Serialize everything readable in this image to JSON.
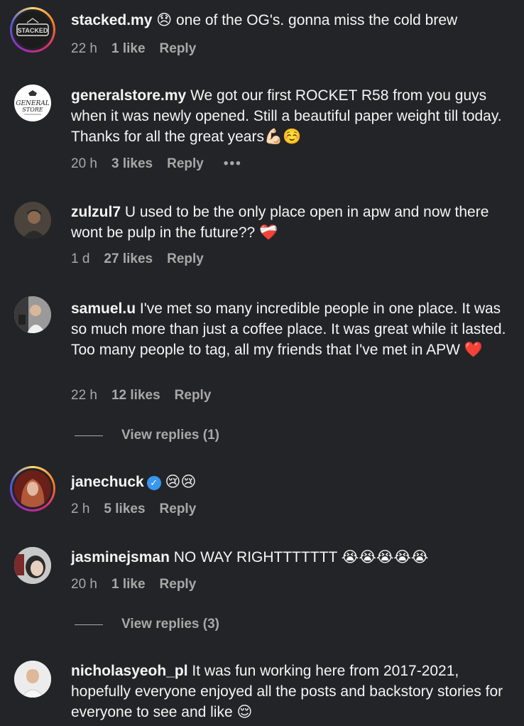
{
  "comments": [
    {
      "username": "stacked.my",
      "text": " 😞 one of the OG's. gonna miss the cold brew",
      "time": "22 h",
      "likes": "1 like",
      "reply": "Reply"
    },
    {
      "username": "generalstore.my",
      "text": " We got our first ROCKET R58 from you guys when it was newly opened. Still a beautiful paper weight till today. Thanks for all the great years💪🏻☺️",
      "time": "20 h",
      "likes": "3 likes",
      "reply": "Reply",
      "more": "•••"
    },
    {
      "username": "zulzul7",
      "text": " U used to be the only place open in apw and now there wont be pulp in the future?? ❤️‍🩹",
      "time": "1 d",
      "likes": "27 likes",
      "reply": "Reply"
    },
    {
      "username": "samuel.u",
      "text": " I've met so many incredible people in one place. It was so much more than just a coffee place. It was great while it lasted. Too many people to tag, all my friends that I've met in APW ❤️",
      "time": "22 h",
      "likes": "12 likes",
      "reply": "Reply",
      "view_replies": "View replies (1)"
    },
    {
      "username": "janechuck",
      "text": " 😢😢",
      "time": "2 h",
      "likes": "5 likes",
      "reply": "Reply"
    },
    {
      "username": "jasminejsman",
      "text": " NO WAY RIGHTTTTTTT 😭😭😭😭😭",
      "time": "20 h",
      "likes": "1 like",
      "reply": "Reply",
      "view_replies": "View replies (3)"
    },
    {
      "username": "nicholasyeoh_pl",
      "text": " It was fun working here from 2017-2021, hopefully everyone enjoyed all the posts and backstory stories for everyone to see and like 😌"
    }
  ],
  "logos": {
    "stacked": "STACKED",
    "general_top": "GENERAL",
    "general_bottom": "STORE"
  },
  "colors": {
    "background": "#232427",
    "text": "#f5f5f5",
    "muted": "#a8a8a8",
    "verified": "#3897f0"
  }
}
